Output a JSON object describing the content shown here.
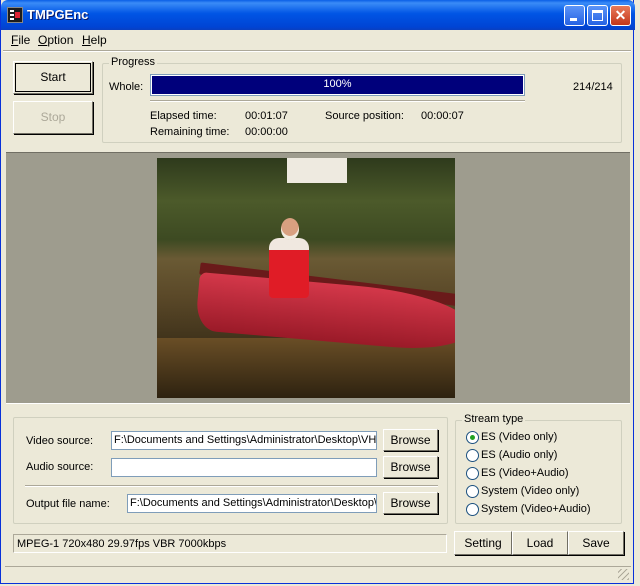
{
  "window": {
    "title": "TMPGEnc"
  },
  "menu": {
    "file": "File",
    "option": "Option",
    "help": "Help"
  },
  "controls": {
    "start": "Start",
    "stop": "Stop"
  },
  "progress": {
    "group_label": "Progress",
    "whole_label": "Whole:",
    "percent_text": "100%",
    "fraction": 1.0,
    "frames": "214/214",
    "elapsed_label": "Elapsed time:",
    "elapsed_value": "00:01:07",
    "remaining_label": "Remaining time:",
    "remaining_value": "00:00:00",
    "source_pos_label": "Source position:",
    "source_pos_value": "00:00:07"
  },
  "sources": {
    "video_label": "Video source:",
    "video_value": "F:\\Documents and Settings\\Administrator\\Desktop\\VH",
    "audio_label": "Audio source:",
    "audio_value": "",
    "output_label": "Output file name:",
    "output_value": "F:\\Documents and Settings\\Administrator\\Desktop\\",
    "browse": "Browse"
  },
  "stream_type": {
    "label": "Stream type",
    "options": [
      {
        "label": "ES (Video only)",
        "checked": true
      },
      {
        "label": "ES (Audio only)",
        "checked": false
      },
      {
        "label": "ES (Video+Audio)",
        "checked": false
      },
      {
        "label": "System (Video only)",
        "checked": false
      },
      {
        "label": "System (Video+Audio)",
        "checked": false
      }
    ]
  },
  "status": {
    "encode_info": "MPEG-1 720x480 29.97fps VBR 7000kbps"
  },
  "actions": {
    "setting": "Setting",
    "load": "Load",
    "save": "Save"
  },
  "colors": {
    "titlebar": "#0055e5",
    "progress_fill": "#00007b",
    "window_bg": "#ece9d8"
  }
}
